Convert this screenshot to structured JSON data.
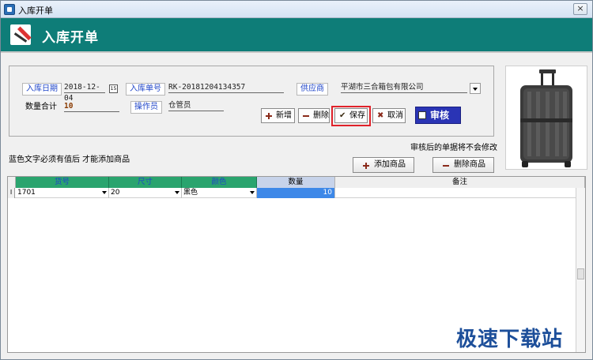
{
  "window": {
    "title": "入库开单",
    "close_glyph": "×"
  },
  "banner": {
    "title": "入库开单"
  },
  "form": {
    "date_label": "入库日期",
    "date_value": "2018-12-04",
    "order_no_label": "入库单号",
    "order_no_value": "RK-20181204134357",
    "supplier_label": "供应商",
    "supplier_value": "平湖市三合箱包有限公司",
    "qty_total_label": "数量合计",
    "qty_total_value": "10",
    "operator_label": "操作员",
    "operator_value": "仓管员"
  },
  "actions": {
    "new": "新增",
    "delete": "删除",
    "save": "保存",
    "cancel": "取消",
    "audit": "审核"
  },
  "notes": {
    "blue_hint": "蓝色文字必须有值后 才能添加商品",
    "audit_hint": "审核后的单据将不会修改"
  },
  "product_buttons": {
    "add": "添加商品",
    "remove": "删除商品"
  },
  "grid": {
    "columns": [
      "货号",
      "尺寸",
      "颜色",
      "数量",
      "备注"
    ],
    "rows": [
      {
        "marker": "I",
        "sku": "1701",
        "size": "20",
        "color": "黑色",
        "qty": "10",
        "note": ""
      }
    ]
  },
  "watermark": "极速下载站",
  "icons": [
    "app-icon",
    "pen-icon",
    "calendar-icon",
    "dropdown-icon",
    "plus-icon",
    "minus-icon",
    "check-icon",
    "x-icon",
    "checkbox-icon",
    "suitcase-image"
  ],
  "colors": {
    "banner": "#0e7d78",
    "label_blue": "#1f45c8",
    "audit": "#2a34b5",
    "highlight": "#e0222a",
    "qty_cell": "#3d88e8"
  }
}
